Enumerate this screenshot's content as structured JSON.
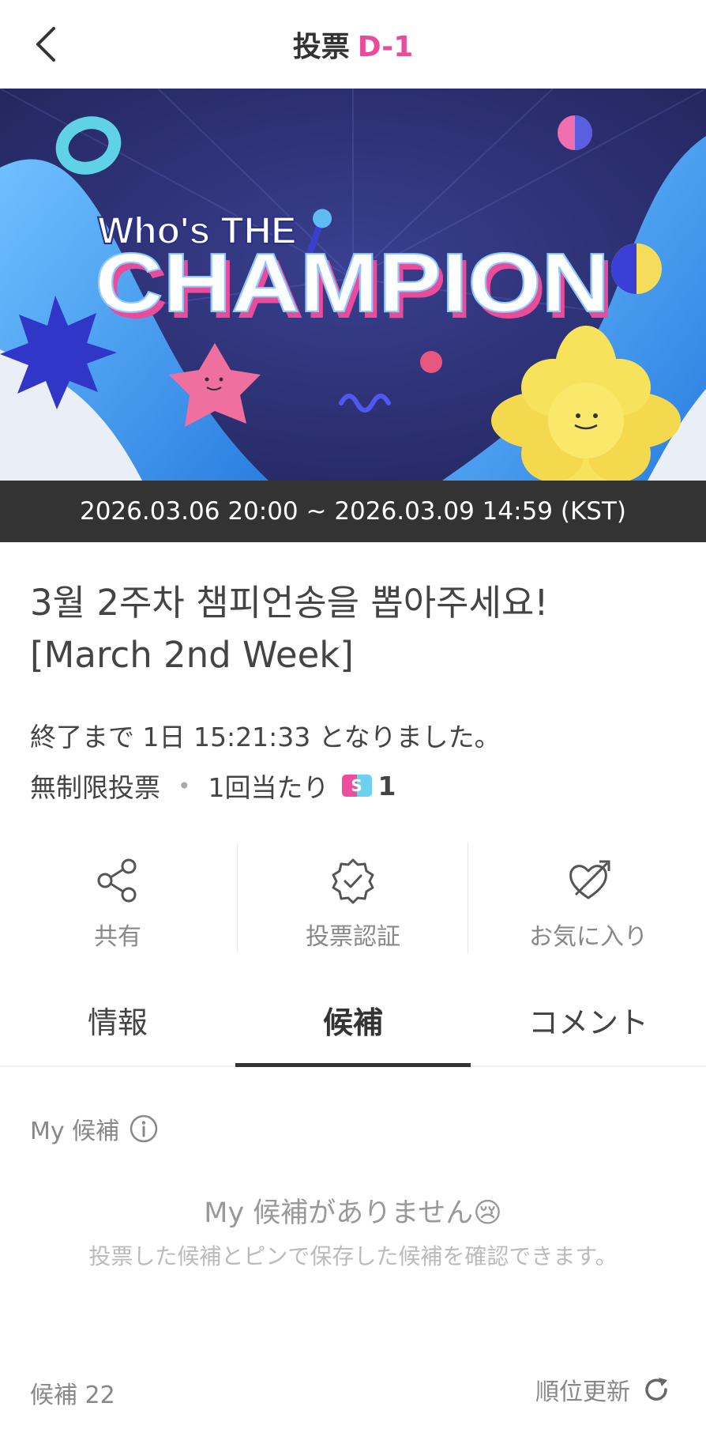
{
  "header": {
    "title": "投票",
    "dday": "D-1"
  },
  "banner": {
    "line1": "Who's THE",
    "line2": "CHAMPION",
    "colors": {
      "bg": "#262a6b",
      "blue": "#3a9bf0",
      "pink": "#ea6a9e",
      "yellow": "#f7e15b"
    }
  },
  "period": "2026.03.06 20:00 ~ 2026.03.09 14:59 (KST)",
  "vote": {
    "title": "3월 2주차 챔피언송을 뽑아주세요! [March 2nd Week]",
    "remaining": "終了まで 1日 15:21:33 となりました。",
    "unlimited": "無制限投票",
    "dot": "•",
    "per_vote": "1回当たり",
    "badge": "S",
    "cost": "1"
  },
  "actions": [
    {
      "label": "共有",
      "icon": "share-icon"
    },
    {
      "label": "投票認証",
      "icon": "verified-badge-icon"
    },
    {
      "label": "お気に入り",
      "icon": "heart-arrow-icon"
    }
  ],
  "tabs": [
    {
      "label": "情報",
      "active": false
    },
    {
      "label": "候補",
      "active": true
    },
    {
      "label": "コメント",
      "active": false
    }
  ],
  "my_candidates": {
    "heading": "My 候補",
    "empty_title": "My 候補がありません😢",
    "empty_sub": "投票した候補とピンで保存した候補を確認できます。"
  },
  "candidates": {
    "count_label": "候補 22",
    "refresh_label": "順位更新"
  }
}
